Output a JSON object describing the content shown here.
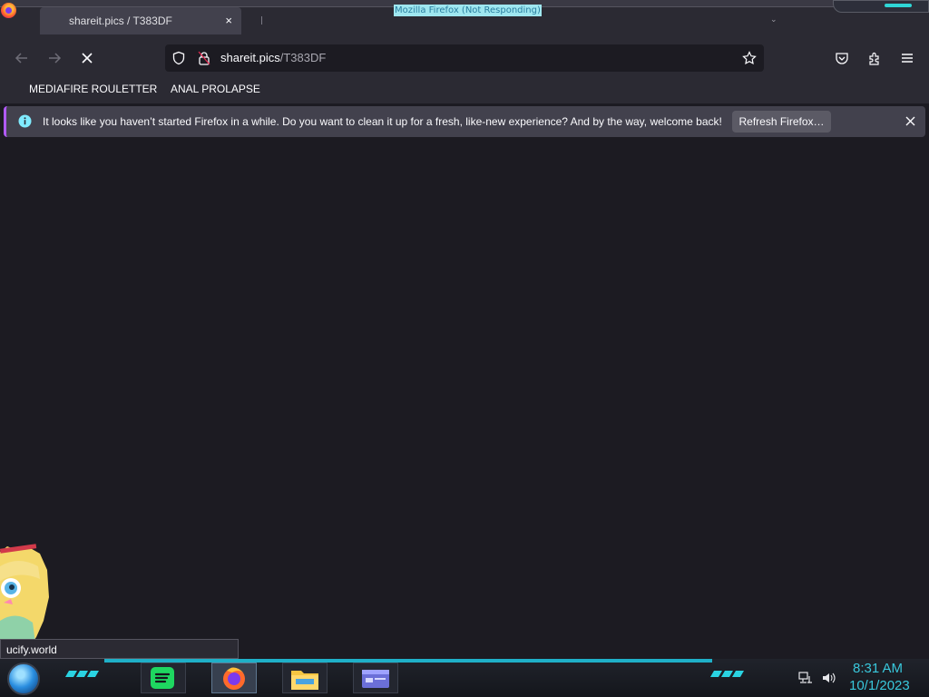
{
  "window": {
    "status": "Mozilla Firefox (Not Responding)"
  },
  "tab": {
    "title": "shareit.pics / T383DF",
    "close_glyph": "×"
  },
  "navbar": {
    "url_domain": "shareit.pics",
    "url_path": "/T383DF",
    "icons": [
      "back-icon",
      "forward-icon",
      "stop-icon",
      "shield-icon",
      "lock-icon",
      "star-icon",
      "pocket-icon",
      "extensions-icon",
      "menu-icon"
    ]
  },
  "bookmarks": [
    {
      "label": "MEDIAFIRE ROULETTER"
    },
    {
      "label": "ANAL PROLAPSE"
    }
  ],
  "notification": {
    "message": "It looks like you haven’t started Firefox in a while. Do you want to clean it up for a fresh, like-new experience? And by the way, welcome back!",
    "button_label": "Refresh Firefox…",
    "close_glyph": "×"
  },
  "status": {
    "text": "ucify.world"
  },
  "taskbar": {
    "apps": [
      "spotify-icon",
      "firefox-icon",
      "file-explorer-icon",
      "window-icon"
    ],
    "active_app": "firefox-icon",
    "time": "8:31 AM",
    "date": "10/1/2023",
    "accent_color": "#2ad3e2"
  }
}
